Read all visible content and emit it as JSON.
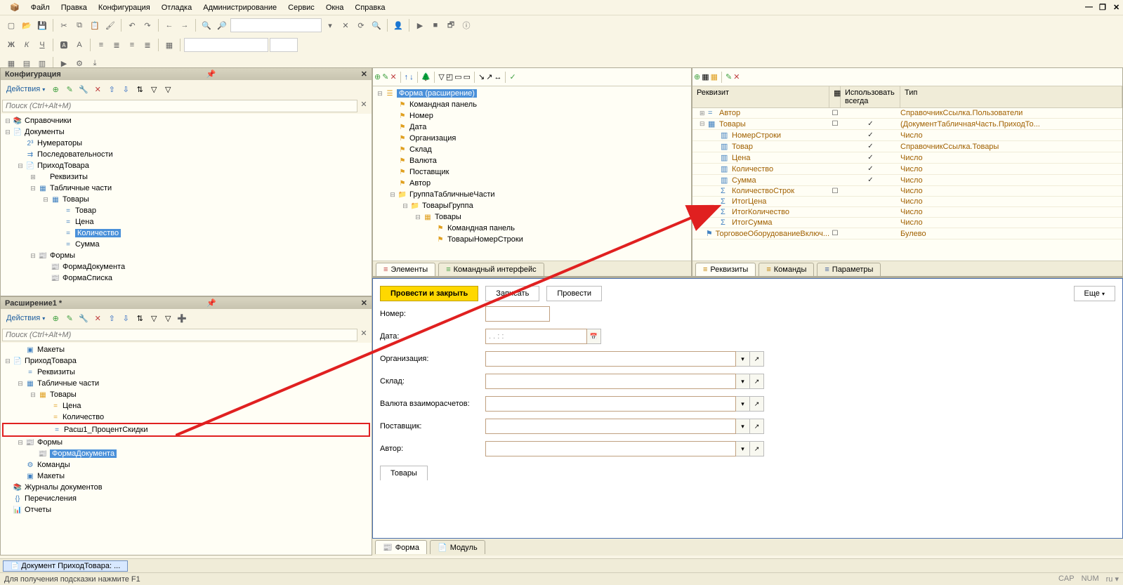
{
  "menu": [
    "Файл",
    "Правка",
    "Конфигурация",
    "Отладка",
    "Администрирование",
    "Сервис",
    "Окна",
    "Справка"
  ],
  "search_placeholder": "Поиск (Ctrl+Alt+M)",
  "panels": {
    "config": {
      "title": "Конфигурация",
      "actions": "Действия",
      "tree": [
        {
          "ind": 0,
          "tgl": "-",
          "icon": "📚",
          "label": "Справочники"
        },
        {
          "ind": 0,
          "tgl": "-",
          "icon": "📄",
          "label": "Документы"
        },
        {
          "ind": 1,
          "tgl": " ",
          "icon": "2³",
          "label": "Нумераторы"
        },
        {
          "ind": 1,
          "tgl": " ",
          "icon": "⇉",
          "label": "Последовательности"
        },
        {
          "ind": 1,
          "tgl": "-",
          "icon": "📄",
          "label": "ПриходТовара"
        },
        {
          "ind": 2,
          "tgl": "+",
          "icon": " ",
          "label": "Реквизиты"
        },
        {
          "ind": 2,
          "tgl": "-",
          "icon": "▦",
          "label": "Табличные части"
        },
        {
          "ind": 3,
          "tgl": "-",
          "icon": "▦",
          "label": "Товары"
        },
        {
          "ind": 4,
          "tgl": " ",
          "icon": "=",
          "label": "Товар"
        },
        {
          "ind": 4,
          "tgl": " ",
          "icon": "=",
          "label": "Цена"
        },
        {
          "ind": 4,
          "tgl": " ",
          "icon": "=",
          "label": "Количество",
          "sel": true
        },
        {
          "ind": 4,
          "tgl": " ",
          "icon": "=",
          "label": "Сумма"
        },
        {
          "ind": 2,
          "tgl": "-",
          "icon": "📰",
          "label": "Формы"
        },
        {
          "ind": 3,
          "tgl": " ",
          "icon": "📰",
          "label": "ФормаДокумента"
        },
        {
          "ind": 3,
          "tgl": " ",
          "icon": "📰",
          "label": "ФормаСписка"
        }
      ]
    },
    "ext": {
      "title": "Расширение1 *",
      "actions": "Действия",
      "tree": [
        {
          "ind": 1,
          "tgl": " ",
          "icon": "▣",
          "label": "Макеты"
        },
        {
          "ind": 0,
          "tgl": "-",
          "icon": "📄",
          "label": "ПриходТовара",
          "yel": true
        },
        {
          "ind": 1,
          "tgl": " ",
          "icon": "=",
          "label": "Реквизиты"
        },
        {
          "ind": 1,
          "tgl": "-",
          "icon": "▦",
          "label": "Табличные части"
        },
        {
          "ind": 2,
          "tgl": "-",
          "icon": "▦",
          "label": "Товары",
          "yel": true
        },
        {
          "ind": 3,
          "tgl": " ",
          "icon": "=",
          "label": "Цена",
          "yel": true
        },
        {
          "ind": 3,
          "tgl": " ",
          "icon": "=",
          "label": "Количество",
          "yel": true
        },
        {
          "ind": 3,
          "tgl": " ",
          "icon": "=",
          "label": "Расш1_ПроцентСкидки",
          "redbox": true
        },
        {
          "ind": 1,
          "tgl": "-",
          "icon": "📰",
          "label": "Формы",
          "yel": true
        },
        {
          "ind": 2,
          "tgl": " ",
          "icon": "📰",
          "label": "ФормаДокумента",
          "sel": true,
          "yel": true
        },
        {
          "ind": 1,
          "tgl": " ",
          "icon": "⚙",
          "label": "Команды"
        },
        {
          "ind": 1,
          "tgl": " ",
          "icon": "▣",
          "label": "Макеты"
        },
        {
          "ind": 0,
          "tgl": " ",
          "icon": "📚",
          "label": "Журналы документов"
        },
        {
          "ind": 0,
          "tgl": " ",
          "icon": "{}",
          "label": "Перечисления"
        },
        {
          "ind": 0,
          "tgl": " ",
          "icon": "📊",
          "label": "Отчеты"
        }
      ]
    }
  },
  "elements": {
    "tree": [
      {
        "ind": 0,
        "tgl": "-",
        "icon": "☰",
        "label": "Форма (расширение)",
        "sel": true
      },
      {
        "ind": 1,
        "tgl": " ",
        "icon": "⚑",
        "label": "Командная панель"
      },
      {
        "ind": 1,
        "tgl": " ",
        "icon": "⚑",
        "label": "Номер"
      },
      {
        "ind": 1,
        "tgl": " ",
        "icon": "⚑",
        "label": "Дата"
      },
      {
        "ind": 1,
        "tgl": " ",
        "icon": "⚑",
        "label": "Организация"
      },
      {
        "ind": 1,
        "tgl": " ",
        "icon": "⚑",
        "label": "Склад"
      },
      {
        "ind": 1,
        "tgl": " ",
        "icon": "⚑",
        "label": "Валюта"
      },
      {
        "ind": 1,
        "tgl": " ",
        "icon": "⚑",
        "label": "Поставщик"
      },
      {
        "ind": 1,
        "tgl": " ",
        "icon": "⚑",
        "label": "Автор"
      },
      {
        "ind": 1,
        "tgl": "-",
        "icon": "📁",
        "label": "ГруппаТабличныеЧасти"
      },
      {
        "ind": 2,
        "tgl": "-",
        "icon": "📁",
        "label": "ТоварыГруппа"
      },
      {
        "ind": 3,
        "tgl": "-",
        "icon": "▦",
        "label": "Товары"
      },
      {
        "ind": 4,
        "tgl": " ",
        "icon": "⚑",
        "label": "Командная панель"
      },
      {
        "ind": 4,
        "tgl": " ",
        "icon": "⚑",
        "label": "ТоварыНомерСтроки"
      }
    ],
    "tabs": [
      "Элементы",
      "Командный интерфейс"
    ]
  },
  "attrs": {
    "head": {
      "name": "Реквизит",
      "use": "Использовать всегда",
      "type": "Тип"
    },
    "rows": [
      {
        "ind": 0,
        "tgl": "+",
        "icon": "=",
        "name": "Автор",
        "c1": "☐",
        "use": "",
        "type": "СправочникСсылка.Пользователи"
      },
      {
        "ind": 0,
        "tgl": "-",
        "icon": "▦",
        "name": "Товары",
        "c1": "☐",
        "use": "✓",
        "type": "(ДокументТабличнаяЧасть.ПриходТо..."
      },
      {
        "ind": 1,
        "tgl": " ",
        "icon": "▥",
        "name": "НомерСтроки",
        "c1": "",
        "use": "✓",
        "type": "Число"
      },
      {
        "ind": 1,
        "tgl": " ",
        "icon": "▥",
        "name": "Товар",
        "c1": "",
        "use": "✓",
        "type": "СправочникСсылка.Товары"
      },
      {
        "ind": 1,
        "tgl": " ",
        "icon": "▥",
        "name": "Цена",
        "c1": "",
        "use": "✓",
        "type": "Число"
      },
      {
        "ind": 1,
        "tgl": " ",
        "icon": "▥",
        "name": "Количество",
        "c1": "",
        "use": "✓",
        "type": "Число"
      },
      {
        "ind": 1,
        "tgl": " ",
        "icon": "▥",
        "name": "Сумма",
        "c1": "",
        "use": "✓",
        "type": "Число"
      },
      {
        "ind": 1,
        "tgl": " ",
        "icon": "Σ",
        "name": "КоличествоСтрок",
        "c1": "☐",
        "use": "",
        "type": "Число"
      },
      {
        "ind": 1,
        "tgl": " ",
        "icon": "Σ",
        "name": "ИтогЦена",
        "c1": "",
        "use": "",
        "type": "Число"
      },
      {
        "ind": 1,
        "tgl": " ",
        "icon": "Σ",
        "name": "ИтогКоличество",
        "c1": "",
        "use": "",
        "type": "Число"
      },
      {
        "ind": 1,
        "tgl": " ",
        "icon": "Σ",
        "name": "ИтогСумма",
        "c1": "",
        "use": "",
        "type": "Число"
      },
      {
        "ind": 0,
        "tgl": " ",
        "icon": "⚑",
        "name": "ТорговоеОборудованиеВключ...",
        "c1": "☐",
        "use": "",
        "type": "Булево"
      }
    ],
    "tabs": [
      "Реквизиты",
      "Команды",
      "Параметры"
    ]
  },
  "form": {
    "btn_post_close": "Провести и закрыть",
    "btn_save": "Записать",
    "btn_post": "Провести",
    "btn_more": "Еще",
    "labels": {
      "num": "Номер:",
      "date": "Дата:",
      "org": "Организация:",
      "wh": "Склад:",
      "curr": "Валюта взаиморасчетов:",
      "supp": "Поставщик:",
      "author": "Автор:"
    },
    "date_value": " .  .      :  :",
    "tab_goods": "Товары",
    "bottom_tabs": [
      "Форма",
      "Модуль"
    ]
  },
  "doc_tab": "Документ ПриходТовара: ...",
  "status": "Для получения подсказки нажмите F1",
  "status_right": [
    "CAP",
    "NUM",
    "ru"
  ]
}
